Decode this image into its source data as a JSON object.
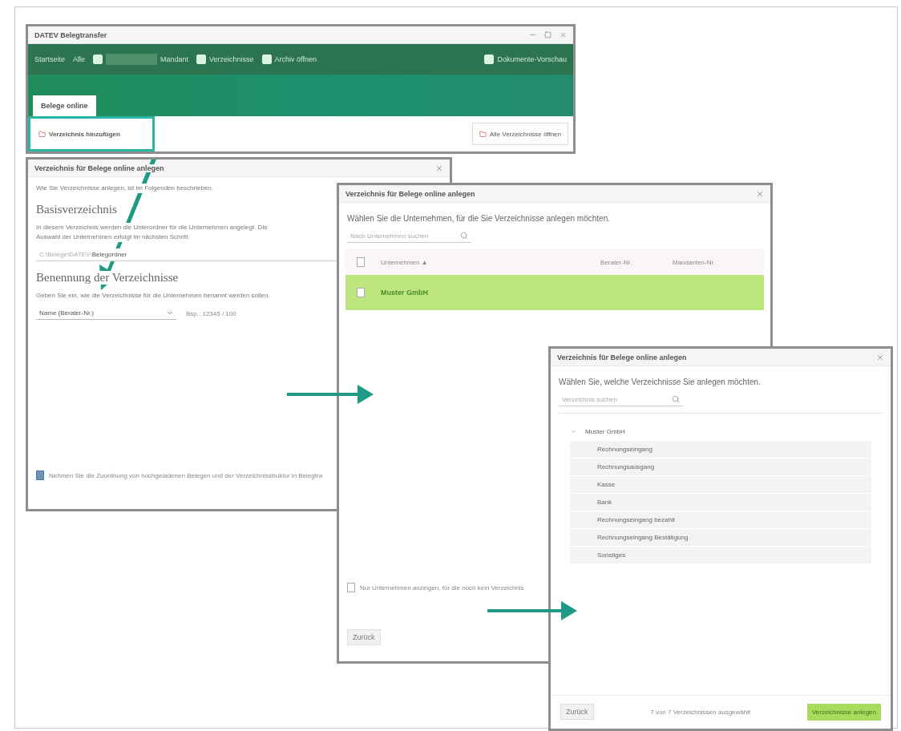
{
  "app_window": {
    "title": "DATEV Belegtransfer",
    "toolbar": [
      {
        "kind": "link",
        "label": "Startseite"
      },
      {
        "kind": "link",
        "label": "Alle"
      },
      {
        "kind": "field",
        "label": "Mandant"
      },
      {
        "kind": "icon-link",
        "label": "Verzeichnisse"
      },
      {
        "kind": "icon-link",
        "label": "Archiv öffnen"
      }
    ],
    "toggle": {
      "label": "Dokumente-Vorschau",
      "on": true
    },
    "tabs": [
      {
        "label": "Belege online",
        "selected": true
      }
    ],
    "ribbon_buttons": [
      {
        "label": "Verzeichnis hinzufügen",
        "highlighted": true
      },
      {
        "label": "Alle Verzeichnisse öffnen",
        "highlighted": false
      }
    ]
  },
  "basis_dialog": {
    "title": "Verzeichnis für Belege online anlegen",
    "intro": "Wie Sie Verzeichnisse anlegen, ist im Folgenden beschrieben.",
    "sections": [
      {
        "heading": "Basisverzeichnis",
        "text": "In diesem Verzeichnis werden die Unterordner für die Unternehmen angelegt. Die Auswahl der Unternehmen erfolgt im nächsten Schritt.",
        "kind": "path",
        "path": "C:\\Belege\\DATEV\\",
        "value": "Belegordner"
      },
      {
        "heading": "Benennung der Verzeichnisse",
        "text": "Geben Sie ein, wie die Verzeichnisse für die Unternehmen benannt werden sollen.",
        "kind": "select",
        "value": "Name (Berater-Nr.)",
        "example": "Bsp.: 12345 / 100"
      }
    ],
    "option": {
      "label": "Nehmen Sie die Zuordnung von hochgeladenen Belegen und der Verzeichnisstruktur in Belegtra",
      "checked": true
    }
  },
  "company_dialog": {
    "title": "Verzeichnis für Belege online anlegen",
    "instruction": "Wählen Sie die Unternehmen, für die Sie Verzeichnisse anlegen möchten.",
    "search": {
      "placeholder": "Nach Unternehmen suchen"
    },
    "all_checked": false,
    "columns": [
      "Unternehmen ▲",
      "Berater-Nr.",
      "Mandanten-Nr."
    ],
    "rows": [
      {
        "name": "Muster GmbH",
        "selected": true,
        "checked": false
      }
    ],
    "option": {
      "label": "Nur Unternehmen anzeigen, für die noch kein Verzeichnis",
      "checked": false
    },
    "back_button": "Zurück"
  },
  "folder_dialog": {
    "title": "Verzeichnis für Belege online anlegen",
    "instruction": "Wählen Sie, welche Verzeichnisse Sie anlegen möchten.",
    "search": {
      "placeholder": "Verzeichnis suchen"
    },
    "tree": [
      {
        "label": "Muster GmbH",
        "expanded": true,
        "selected": false,
        "children": [
          {
            "label": "Rechnungseingang",
            "selected": true
          },
          {
            "label": "Rechnungsausgang",
            "selected": true
          },
          {
            "label": "Kasse",
            "selected": true
          },
          {
            "label": "Bank",
            "selected": true
          },
          {
            "label": "Rechnungseingang bezahlt",
            "selected": true
          },
          {
            "label": "Rechnungseingang Bestätigung",
            "selected": true
          },
          {
            "label": "Sonstiges",
            "selected": true
          }
        ]
      }
    ],
    "back_button": "Zurück",
    "status": "7 von 7 Verzeichnissen ausgewählt",
    "submit_button": "Verzeichnisse anlegen"
  }
}
